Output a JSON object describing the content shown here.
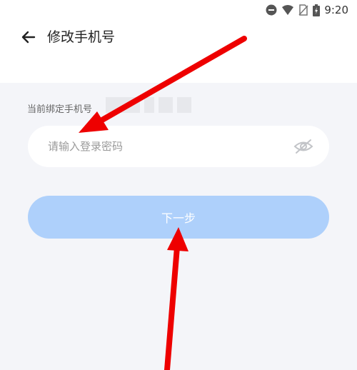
{
  "status_bar": {
    "time": "9:20"
  },
  "header": {
    "title": "修改手机号"
  },
  "form": {
    "bound_phone_label": "当前绑定手机号",
    "password_placeholder": "请输入登录密码",
    "next_label": "下一步"
  },
  "colors": {
    "accent_disabled": "#aed0fb",
    "annotation_arrow": "#ee0000"
  }
}
